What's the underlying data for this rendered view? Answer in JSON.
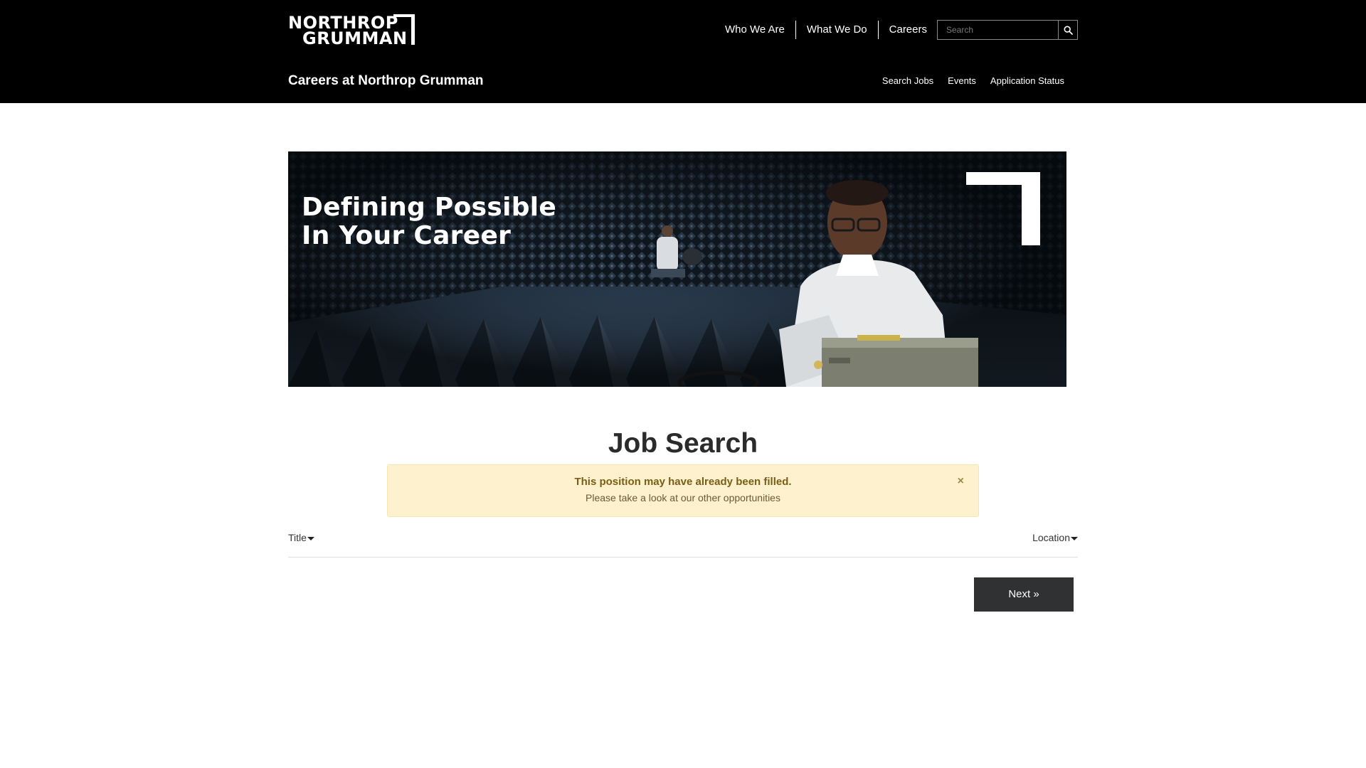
{
  "header": {
    "logo": {
      "line1": "NORTHROP",
      "line2": "GRUMMAN"
    },
    "main_nav": [
      {
        "label": "Who We Are"
      },
      {
        "label": "What We Do"
      },
      {
        "label": "Careers"
      }
    ],
    "search": {
      "placeholder": "Search"
    },
    "careers_title": "Careers at Northrop Grumman",
    "sub_nav": [
      {
        "label": "Search Jobs"
      },
      {
        "label": "Events"
      },
      {
        "label": "Application Status"
      }
    ]
  },
  "hero": {
    "line1": "Defining Possible",
    "line2": "In Your Career"
  },
  "main": {
    "heading": "Job Search",
    "alert": {
      "title": "This position may have already been filled.",
      "text": "Please take a look at our other opportunities",
      "close": "×"
    },
    "sort": {
      "title_label": "Title",
      "location_label": "Location"
    },
    "next_label": "Next »"
  },
  "colors": {
    "header_bg": "#000000",
    "alert_bg": "#fdf2cd",
    "alert_title": "#7a5d16",
    "button_bg": "#2f3132"
  }
}
